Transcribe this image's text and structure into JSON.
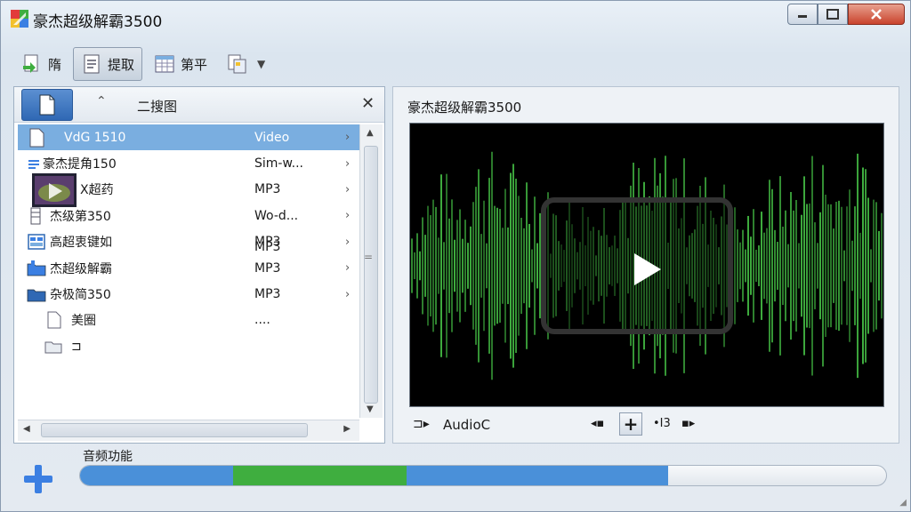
{
  "window": {
    "title": "豪杰超级解霸3500"
  },
  "toolbar": {
    "buttons": [
      {
        "label": "隋"
      },
      {
        "label": "提取"
      },
      {
        "label": "第平"
      }
    ]
  },
  "left_panel": {
    "title": "二搜图",
    "rows": [
      {
        "name": "VdG 1510",
        "type": "Video",
        "arrow": "›"
      },
      {
        "name": "豪杰提角150",
        "type": "Sim-w...",
        "arrow": "›"
      },
      {
        "name": "X超药",
        "type": "MP3",
        "arrow": "›"
      },
      {
        "name": "杰级第350",
        "type": "Wo-d...",
        "arrow": "›"
      },
      {
        "name": "高超衷键如",
        "type": "MP3",
        "arrow": "›"
      },
      {
        "name": "杰超级解霸",
        "type": "MP3",
        "arrow": "›"
      },
      {
        "name": "杂极简350",
        "type": "MP3",
        "arrow": "›"
      },
      {
        "name": "美圈",
        "type": "....",
        "arrow": ""
      },
      {
        "name": "⊐",
        "type": "",
        "arrow": ""
      }
    ],
    "extra_type": "MP3"
  },
  "right_panel": {
    "title": "豪杰超级解霸3500",
    "audio_label": "AudioC",
    "controls": {
      "prev": "◂▪",
      "add": "+",
      "step": "•I3",
      "next": "▪▸"
    }
  },
  "bottom": {
    "label": "音频功能",
    "progress_segments": [
      {
        "start": 0.0,
        "end": 0.19,
        "color": "#4a90d9"
      },
      {
        "start": 0.19,
        "end": 0.405,
        "color": "#3fae3f"
      },
      {
        "start": 0.405,
        "end": 0.73,
        "color": "#4a90d9"
      }
    ]
  },
  "colors": {
    "selection": "#7aaee0",
    "wave_green": "#3fae3f",
    "progress_blue": "#4a90d9"
  }
}
